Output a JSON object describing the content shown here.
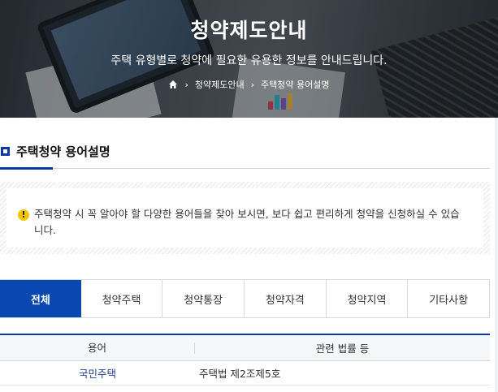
{
  "hero": {
    "title": "청약제도안내",
    "subtitle": "주택 유형별로 청약에 필요한 유용한 정보를 안내드립니다.",
    "breadcrumb": [
      "청약제도안내",
      "주택청약 용어설명"
    ]
  },
  "section": {
    "title": "주택청약 용어설명"
  },
  "notice": {
    "icon": "warning-icon",
    "text": "주택청약 시 꼭 알아야 할 다양한 용어들을 찾아 보시면, 보다 쉽고 편리하게 청약을 신청하실 수 있습니다."
  },
  "tabs": [
    {
      "label": "전체",
      "active": true
    },
    {
      "label": "청약주택",
      "active": false
    },
    {
      "label": "청약통장",
      "active": false
    },
    {
      "label": "청약자격",
      "active": false
    },
    {
      "label": "청약지역",
      "active": false
    },
    {
      "label": "기타사항",
      "active": false
    }
  ],
  "table": {
    "headers": [
      "용어",
      "관련 법률 등"
    ],
    "rows": [
      {
        "term": "국민주택",
        "law": "주택법 제2조제5호"
      }
    ]
  },
  "colors": {
    "accent": "#0b47b0",
    "term_link": "#1e3f91",
    "warning": "#f2c600"
  }
}
